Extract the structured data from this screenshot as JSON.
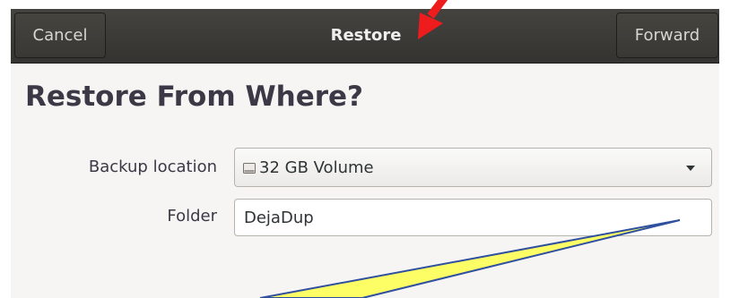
{
  "headerbar": {
    "cancel_label": "Cancel",
    "title": "Restore",
    "forward_label": "Forward"
  },
  "page": {
    "title": "Restore From Where?"
  },
  "form": {
    "backup_location_label": "Backup location",
    "backup_location_value": "32 GB Volume",
    "backup_location_icon": "drive-icon",
    "dropdown_icon": "chevron-down-icon",
    "folder_label": "Folder",
    "folder_value": "DejaDup"
  },
  "annotations": {
    "arrow_color": "#ee1c1c",
    "callout_fill": "#fdfd66",
    "callout_stroke": "#2f4f9f"
  }
}
